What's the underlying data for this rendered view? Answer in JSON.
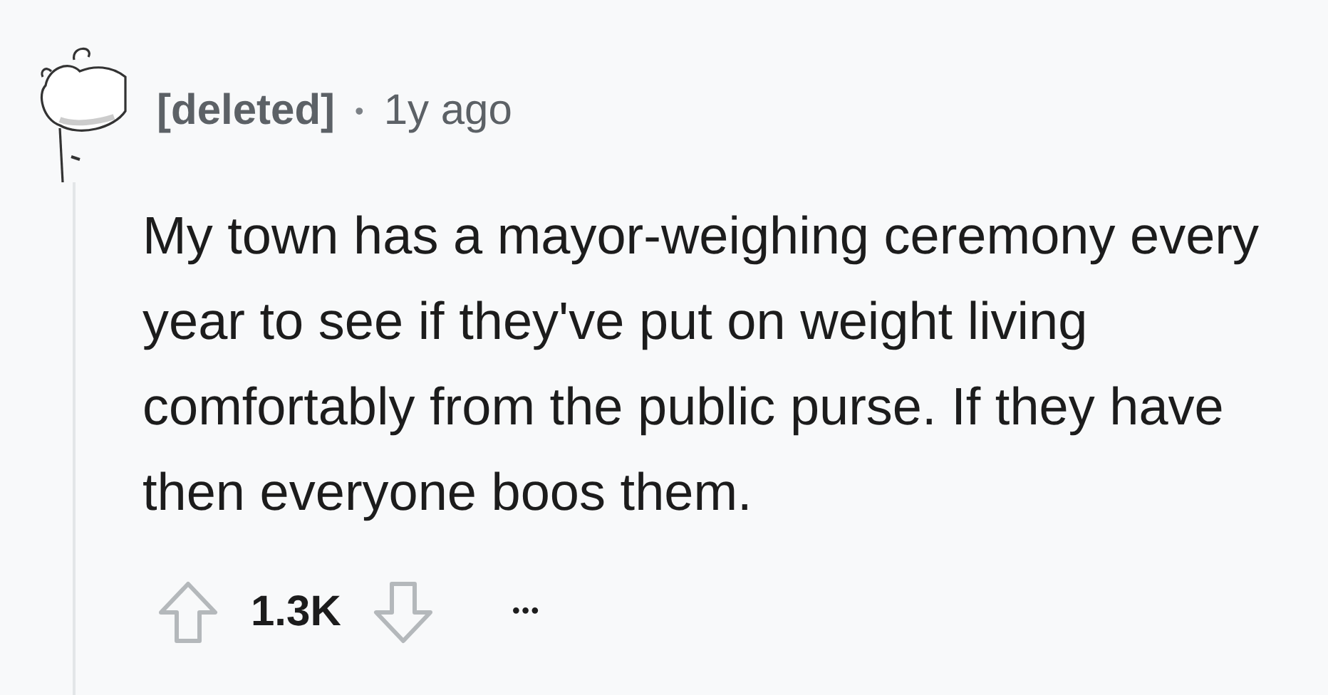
{
  "comment": {
    "author": "[deleted]",
    "separator": "•",
    "time": "1y ago",
    "body": "My town has a mayor-weighing ceremony every year to see if they've put on weight living comfortably from the public purse. If they have then everyone boos them.",
    "score": "1.3K",
    "more": "•••"
  }
}
